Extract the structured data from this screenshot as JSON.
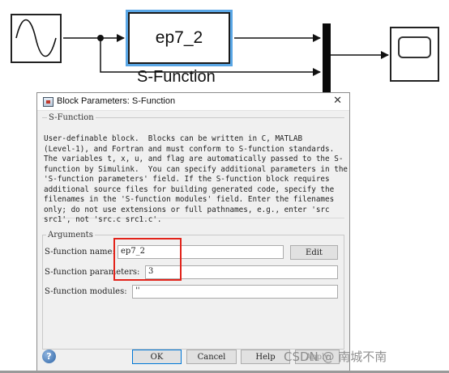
{
  "model": {
    "sfunction_block_label": "ep7_2",
    "sfunction_caption": "S-Function"
  },
  "dialog": {
    "title": "Block Parameters: S-Function",
    "close_glyph": "✕",
    "sfunction_group_label": "S-Function",
    "description": "User-definable block.  Blocks can be written in C, MATLAB\n(Level-1), and Fortran and must conform to S-function standards.\nThe variables t, x, u, and flag are automatically passed to the S-\nfunction by Simulink.  You can specify additional parameters in the\n'S-function parameters' field. If the S-function block requires\nadditional source files for building generated code, specify the\nfilenames in the 'S-function modules' field. Enter the filenames\nonly; do not use extensions or full pathnames, e.g., enter 'src\nsrc1', not 'src.c src1.c'.",
    "arguments_group_label": "Arguments",
    "fields": {
      "name_label": "S-function name:",
      "name_value": "ep7_2",
      "params_label": "S-function parameters:",
      "params_value": "3",
      "modules_label": "S-function modules:",
      "modules_value": "''"
    },
    "buttons": {
      "edit": "Edit",
      "ok": "OK",
      "cancel": "Cancel",
      "help": "Help",
      "apply": "Apply"
    },
    "help_icon_glyph": "?"
  },
  "watermark": "CSDN @ 南城不南",
  "icons": [
    "sine-wave-icon",
    "scope-icon",
    "mux-icon",
    "help-icon",
    "block-params-icon",
    "close-icon"
  ],
  "colors": {
    "selected_block_border": "#5aa7e6",
    "highlight_box": "#e2231a",
    "ok_focus_border": "#0078d7"
  }
}
